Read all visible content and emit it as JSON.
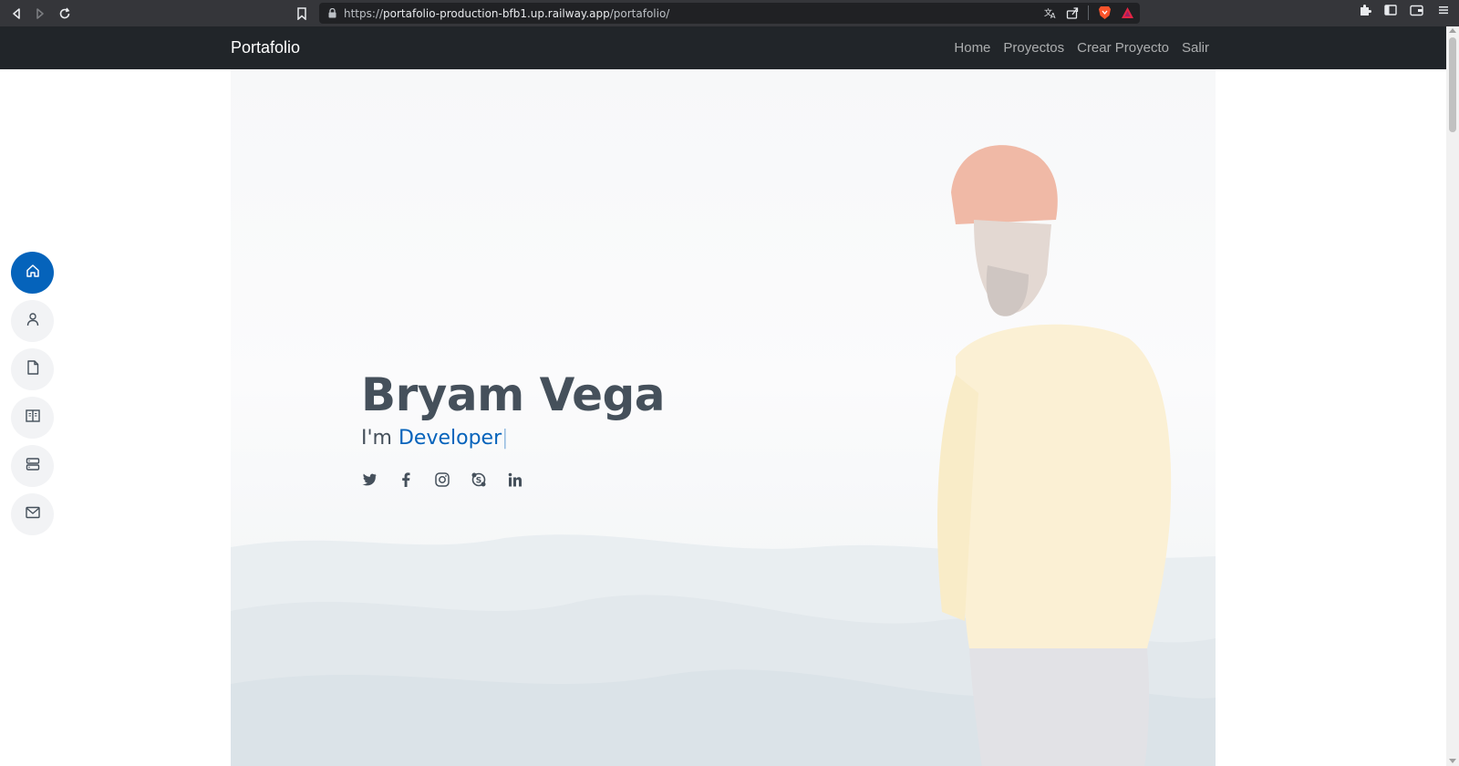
{
  "browser": {
    "url_scheme": "https://",
    "url_host": "portafolio-production-bfb1.up.railway.app",
    "url_path": "/portafolio/",
    "icons": [
      "back-icon",
      "forward-icon",
      "reload-icon",
      "bookmark-icon",
      "lock-icon",
      "translate-icon",
      "share-icon",
      "brave-shield-icon",
      "brave-rewards-icon",
      "extensions-icon",
      "sidebar-icon",
      "wallet-icon",
      "menu-icon"
    ]
  },
  "navbar": {
    "brand": "Portafolio",
    "links": [
      "Home",
      "Proyectos",
      "Crear Proyecto",
      "Salir"
    ]
  },
  "hero": {
    "name": "Bryam Vega",
    "prefix": "I'm ",
    "typed": "Developer",
    "cursor": "|",
    "socials": [
      "twitter-icon",
      "facebook-icon",
      "instagram-icon",
      "skype-icon",
      "linkedin-icon"
    ]
  },
  "side_nav": {
    "items": [
      {
        "icon": "home-icon",
        "active": true
      },
      {
        "icon": "person-icon",
        "active": false
      },
      {
        "icon": "file-icon",
        "active": false
      },
      {
        "icon": "book-icon",
        "active": false
      },
      {
        "icon": "server-icon",
        "active": false
      },
      {
        "icon": "envelope-icon",
        "active": false
      }
    ]
  },
  "colors": {
    "accent": "#0563bb",
    "navbar_bg": "#212529",
    "heading": "#45505b"
  }
}
